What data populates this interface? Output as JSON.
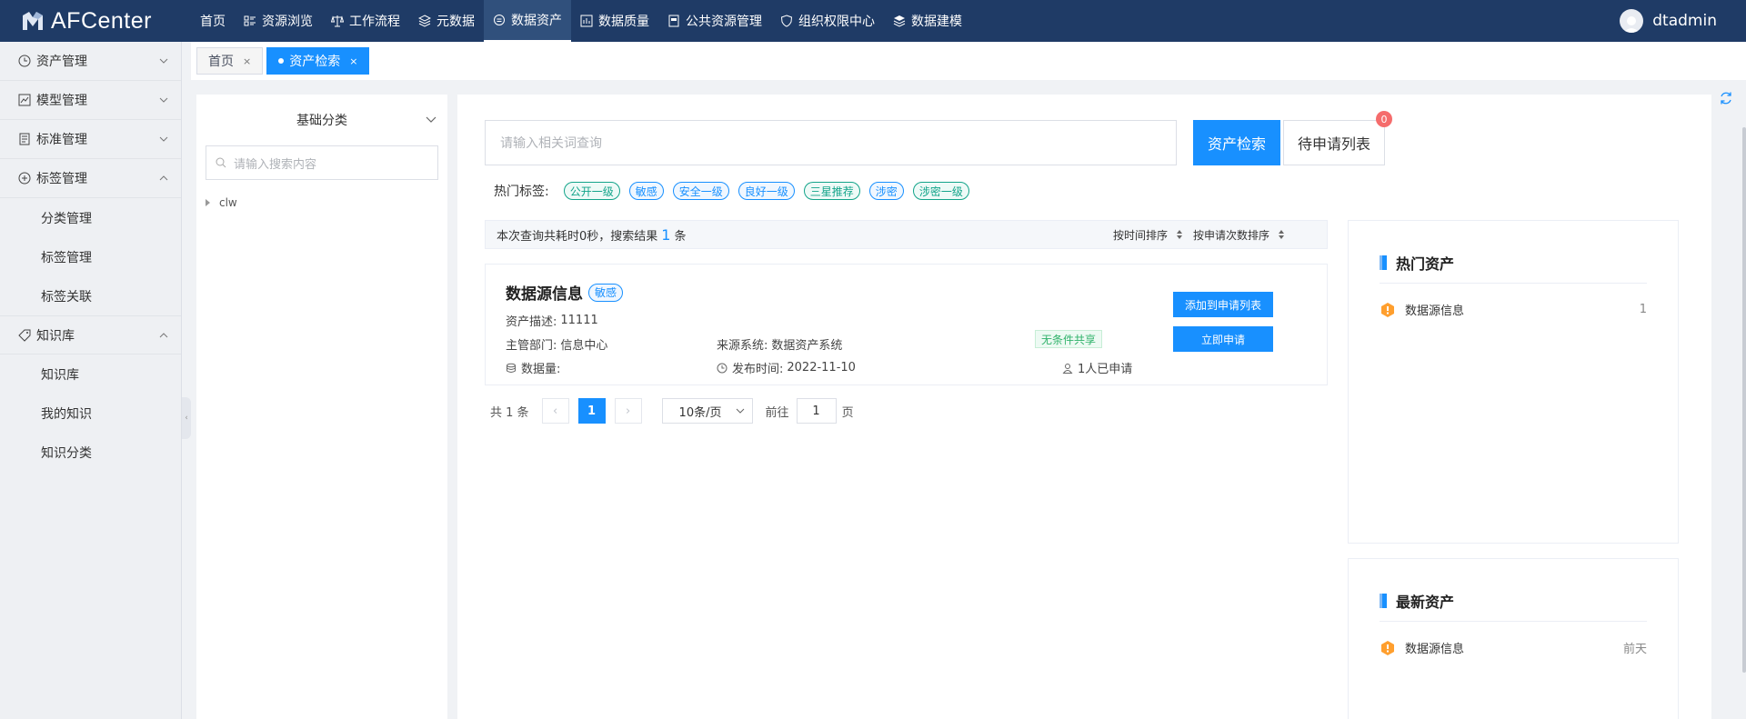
{
  "app": {
    "name": "AFCenter"
  },
  "nav": [
    {
      "label": "首页",
      "icon": "none"
    },
    {
      "label": "资源浏览",
      "icon": "list-icon"
    },
    {
      "label": "工作流程",
      "icon": "scale-icon"
    },
    {
      "label": "元数据",
      "icon": "layers-icon"
    },
    {
      "label": "数据资产",
      "icon": "database-icon",
      "active": true
    },
    {
      "label": "数据质量",
      "icon": "chart-icon"
    },
    {
      "label": "公共资源管理",
      "icon": "doc-icon"
    },
    {
      "label": "组织权限中心",
      "icon": "shield-icon"
    },
    {
      "label": "数据建模",
      "icon": "stack-icon"
    }
  ],
  "user": {
    "name": "dtadmin"
  },
  "sidebar": {
    "groups": [
      {
        "label": "资产管理",
        "icon": "clock-icon",
        "expanded": false,
        "children": []
      },
      {
        "label": "模型管理",
        "icon": "chart-line-icon",
        "expanded": false,
        "children": []
      },
      {
        "label": "标准管理",
        "icon": "doc-icon",
        "expanded": false,
        "children": []
      },
      {
        "label": "标签管理",
        "icon": "plus-circle-icon",
        "expanded": true,
        "children": [
          "分类管理",
          "标签管理",
          "标签关联"
        ]
      },
      {
        "label": "知识库",
        "icon": "tag-icon",
        "expanded": true,
        "children": [
          "知识库",
          "我的知识",
          "知识分类"
        ]
      }
    ]
  },
  "tabs": [
    {
      "label": "首页",
      "active": false
    },
    {
      "label": "资产检索",
      "active": true
    }
  ],
  "left_panel": {
    "title": "基础分类",
    "search_placeholder": "请输入搜索内容",
    "tree": [
      {
        "label": "clw"
      }
    ]
  },
  "search": {
    "placeholder": "请输入相关词查询",
    "search_button": "资产检索",
    "pending_button": "待申请列表",
    "pending_count": "0"
  },
  "hot_tags": {
    "label": "热门标签:",
    "items": [
      {
        "label": "公开一级",
        "color": "green"
      },
      {
        "label": "敏感",
        "color": "blue"
      },
      {
        "label": "安全一级",
        "color": "blue"
      },
      {
        "label": "良好一级",
        "color": "blue"
      },
      {
        "label": "三星推荐",
        "color": "green"
      },
      {
        "label": "涉密",
        "color": "blue"
      },
      {
        "label": "涉密一级",
        "color": "green"
      }
    ]
  },
  "results": {
    "summary_prefix": "本次查询共耗时0秒，搜索结果",
    "count": "1",
    "summary_suffix": "条",
    "sort_time": "按时间排序",
    "sort_apply": "按申请次数排序"
  },
  "asset": {
    "title": "数据源信息",
    "tag": "敏感",
    "desc_label": "资产描述:",
    "desc_value": "11111",
    "dept_label": "主管部门:",
    "dept_value": "信息中心",
    "source_label": "来源系统:",
    "source_value": "数据资产系统",
    "share_tag": "无条件共享",
    "volume_label": "数据量:",
    "volume_value": "",
    "publish_label": "发布时间:",
    "publish_value": "2022-11-10",
    "applicants": "1人已申请",
    "add_button": "添加到申请列表",
    "apply_button": "立即申请"
  },
  "pagination": {
    "total": "共 1 条",
    "current": "1",
    "page_size": "10条/页",
    "goto_label": "前往",
    "goto_value": "1",
    "page_unit": "页"
  },
  "hot_assets": {
    "title": "热门资产",
    "items": [
      {
        "name": "数据源信息",
        "value": "1"
      }
    ]
  },
  "new_assets": {
    "title": "最新资产",
    "items": [
      {
        "name": "数据源信息",
        "value": "前天"
      }
    ]
  },
  "colors": {
    "topbar": "#1f3b66",
    "primary": "#1890ff",
    "badge": "#f56c6c"
  }
}
